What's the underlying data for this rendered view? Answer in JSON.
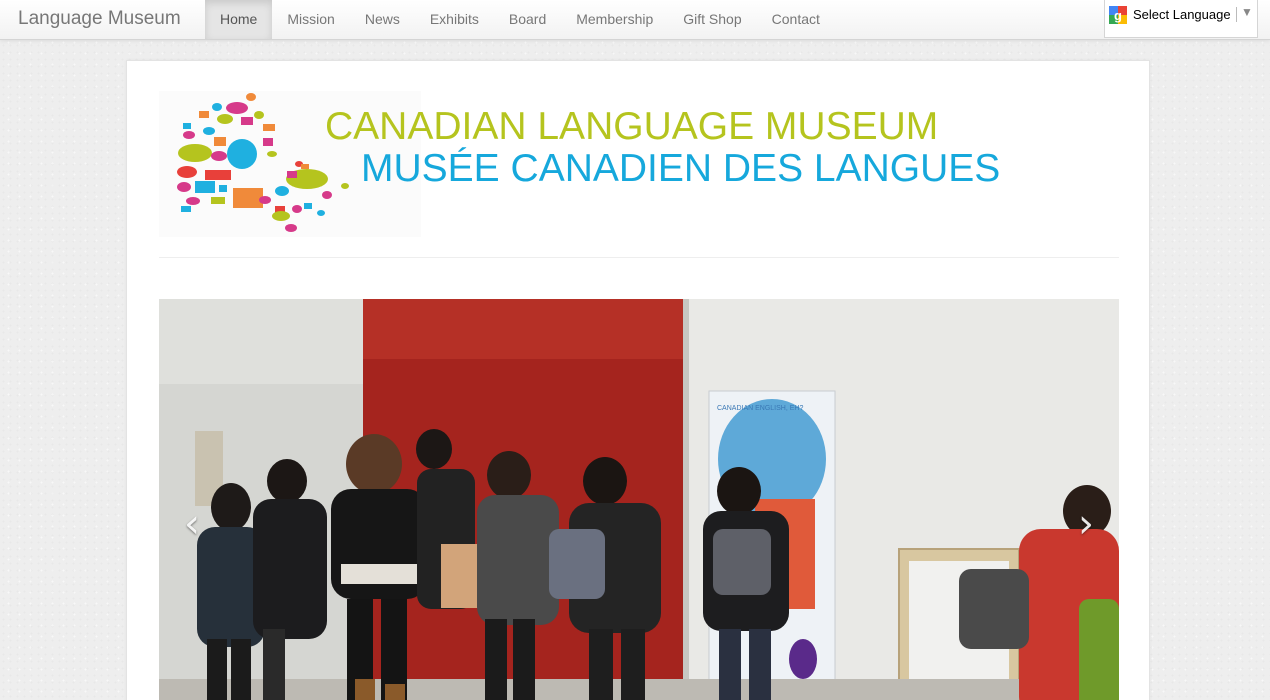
{
  "navbar": {
    "brand": "Language Museum",
    "items": [
      {
        "label": "Home",
        "active": true
      },
      {
        "label": "Mission"
      },
      {
        "label": "News"
      },
      {
        "label": "Exhibits"
      },
      {
        "label": "Board"
      },
      {
        "label": "Membership"
      },
      {
        "label": "Gift Shop"
      },
      {
        "label": "Contact"
      }
    ]
  },
  "translate": {
    "label": "Select Language",
    "icon": "google-g-icon",
    "arrow": "▼"
  },
  "header": {
    "logo_icon": "speech-bubbles-logo",
    "title_en": "CANADIAN LANGUAGE MUSEUM",
    "title_fr": "MUSÉE CANADIEN DES LANGUES",
    "colors": {
      "title_en": "#b5c41e",
      "title_fr": "#16a8dc"
    }
  },
  "carousel": {
    "prev": "‹",
    "next": "›",
    "photo_banner_text": "CANADIAN ENGLISH, EH?"
  }
}
